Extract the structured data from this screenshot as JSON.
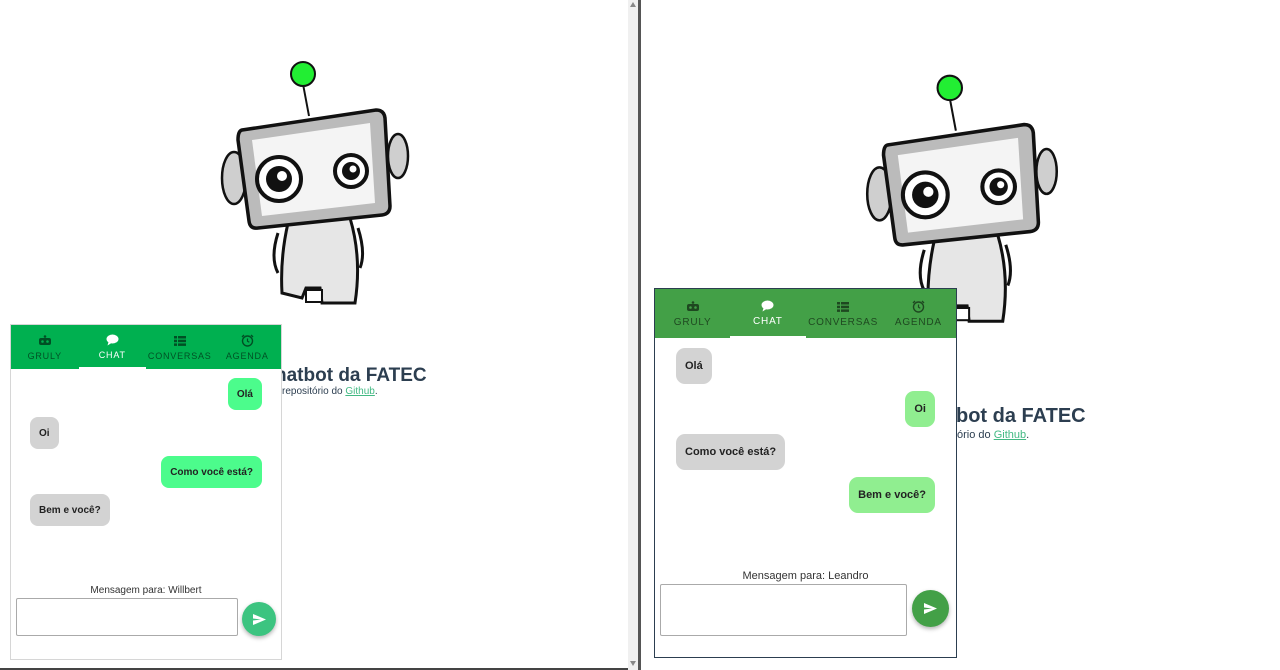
{
  "colors": {
    "tabbar_left": "#00b050",
    "tabbar_right": "#43a047",
    "bubble_green_left": "#4cfc8c",
    "bubble_green_right": "#90ee90",
    "bubble_gray": "#d3d3d3",
    "link": "#42b983"
  },
  "left": {
    "heading": "hatbot da FATEC",
    "subtext_prefix": " repositório do ",
    "subtext_link": "Github",
    "subtext_suffix": ".",
    "tabs": [
      {
        "label": "GRULY",
        "icon": "robot-icon"
      },
      {
        "label": "CHAT",
        "icon": "comment-icon"
      },
      {
        "label": "CONVERSAS",
        "icon": "list-icon"
      },
      {
        "label": "AGENDA",
        "icon": "alarm-clock-icon"
      }
    ],
    "messages": [
      "Olá",
      "Oi",
      "Como você está?",
      "Bem e você?"
    ],
    "to_label": "Mensagem para: Willbert",
    "input_value": "",
    "send_icon": "send-icon"
  },
  "right": {
    "heading": "bot da FATEC",
    "subtext_prefix": "ório do ",
    "subtext_link": "Github",
    "subtext_suffix": ".",
    "tabs": [
      {
        "label": "GRULY",
        "icon": "robot-icon"
      },
      {
        "label": "CHAT",
        "icon": "comment-icon"
      },
      {
        "label": "CONVERSAS",
        "icon": "list-icon"
      },
      {
        "label": "AGENDA",
        "icon": "alarm-clock-icon"
      }
    ],
    "messages": [
      "Olá",
      "Oi",
      "Como você está?",
      "Bem e você?"
    ],
    "to_label": "Mensagem para: Leandro",
    "input_value": "",
    "send_icon": "send-icon"
  }
}
